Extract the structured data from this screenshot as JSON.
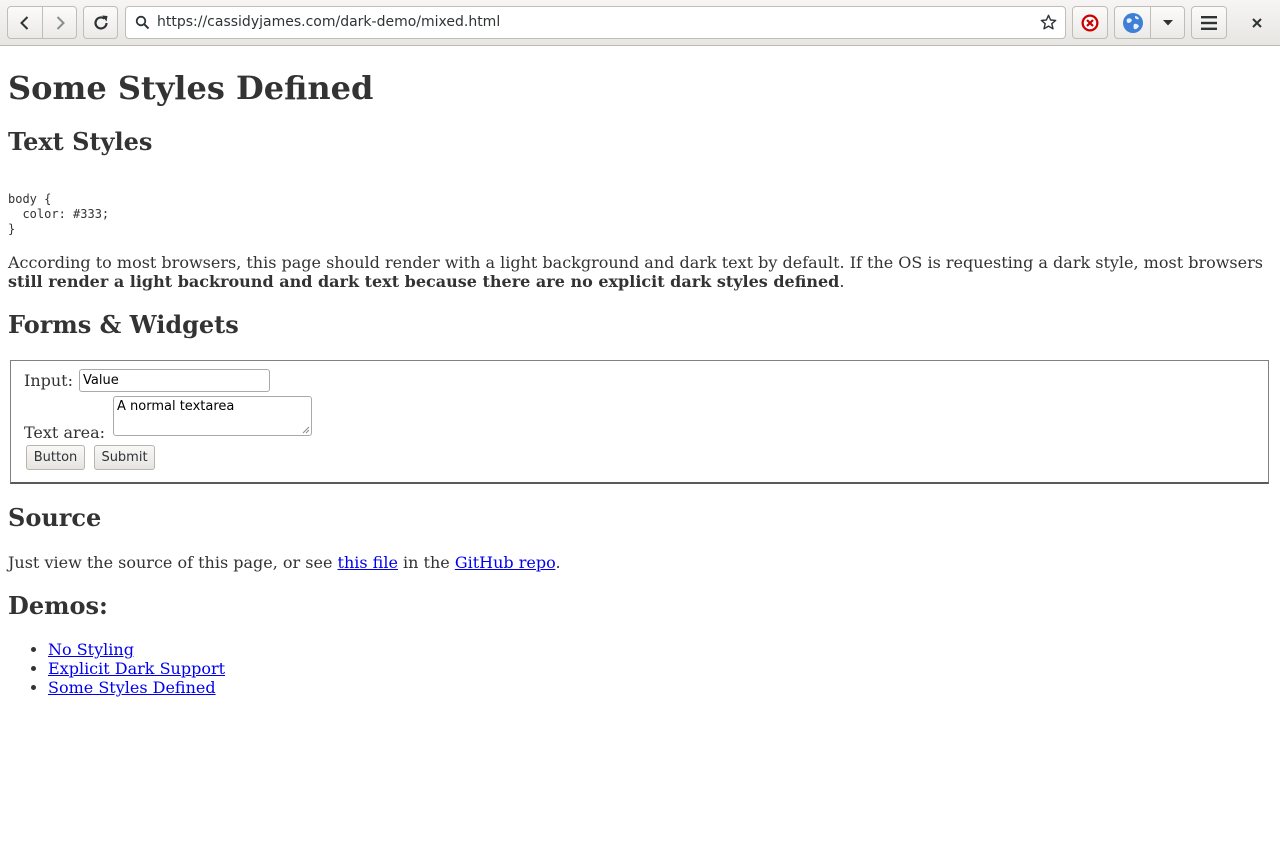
{
  "browser": {
    "url": "https://cassidyjames.com/dark-demo/mixed.html",
    "icons": {
      "back": "back-arrow-icon",
      "forward": "forward-arrow-icon",
      "reload": "reload-icon",
      "search": "search-icon",
      "bookmark": "star-icon",
      "stop": "stop-icon",
      "globe": "globe-icon",
      "dropdown": "chevron-down-icon",
      "menu": "hamburger-menu-icon",
      "close": "close-icon"
    }
  },
  "page": {
    "title": "Some Styles Defined",
    "text_styles_heading": "Text Styles",
    "code": "body {\n  color: #333;\n}",
    "intro_text": "According to most browsers, this page should render with a light background and dark text by default. If the OS is requesting a dark style, most browsers ",
    "intro_bold": "still render a light backround and dark text because there are no explicit dark styles defined",
    "intro_end": ".",
    "forms_heading": "Forms & Widgets",
    "form": {
      "input_label": "Input:",
      "input_value": "Value",
      "textarea_label": "Text area:",
      "textarea_value": "A normal textarea",
      "button_label": "Button",
      "submit_label": "Submit"
    },
    "source_heading": "Source",
    "source_text_1": "Just view the source of this page, or see ",
    "source_link_1": "this file",
    "source_text_2": " in the ",
    "source_link_2": "GitHub repo",
    "source_text_3": ".",
    "demos_heading": "Demos:",
    "demos": [
      "No Styling",
      "Explicit Dark Support",
      "Some Styles Defined"
    ]
  },
  "colors": {
    "text": "#333333",
    "link": "#0000ee",
    "background": "#ffffff"
  }
}
